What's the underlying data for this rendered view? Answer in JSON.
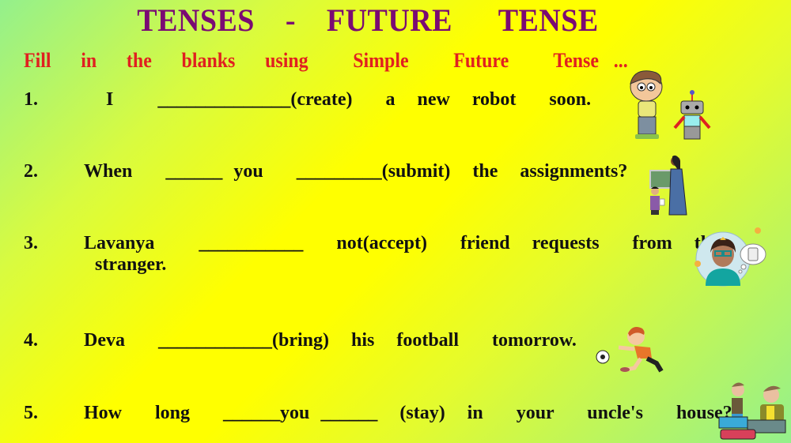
{
  "title": "TENSES  -  FUTURE   TENSE",
  "instruction": "Fill  in  the  blanks  using   Simple   Future   Tense ...",
  "questions": [
    {
      "number": "1.",
      "text": "  I    ______________(create)   a  new  robot   soon."
    },
    {
      "number": "2.",
      "text": "When   ______ you   _________(submit)  the  assignments?"
    },
    {
      "number": "3.",
      "text": "Lavanya    ___________   not(accept)   friend  requests   from  the",
      "continuation": "stranger."
    },
    {
      "number": "4.",
      "text": "Deva   ____________(bring)  his  football   tomorrow."
    },
    {
      "number": "5.",
      "text": "How   long   ______you ______  (stay)  in   your   uncle's   house?"
    }
  ],
  "illustrations": [
    "boy-and-robot",
    "teacher-and-student",
    "girl-thinking-of-phone",
    "boy-kicking-football",
    "two-men-with-suitcases"
  ]
}
